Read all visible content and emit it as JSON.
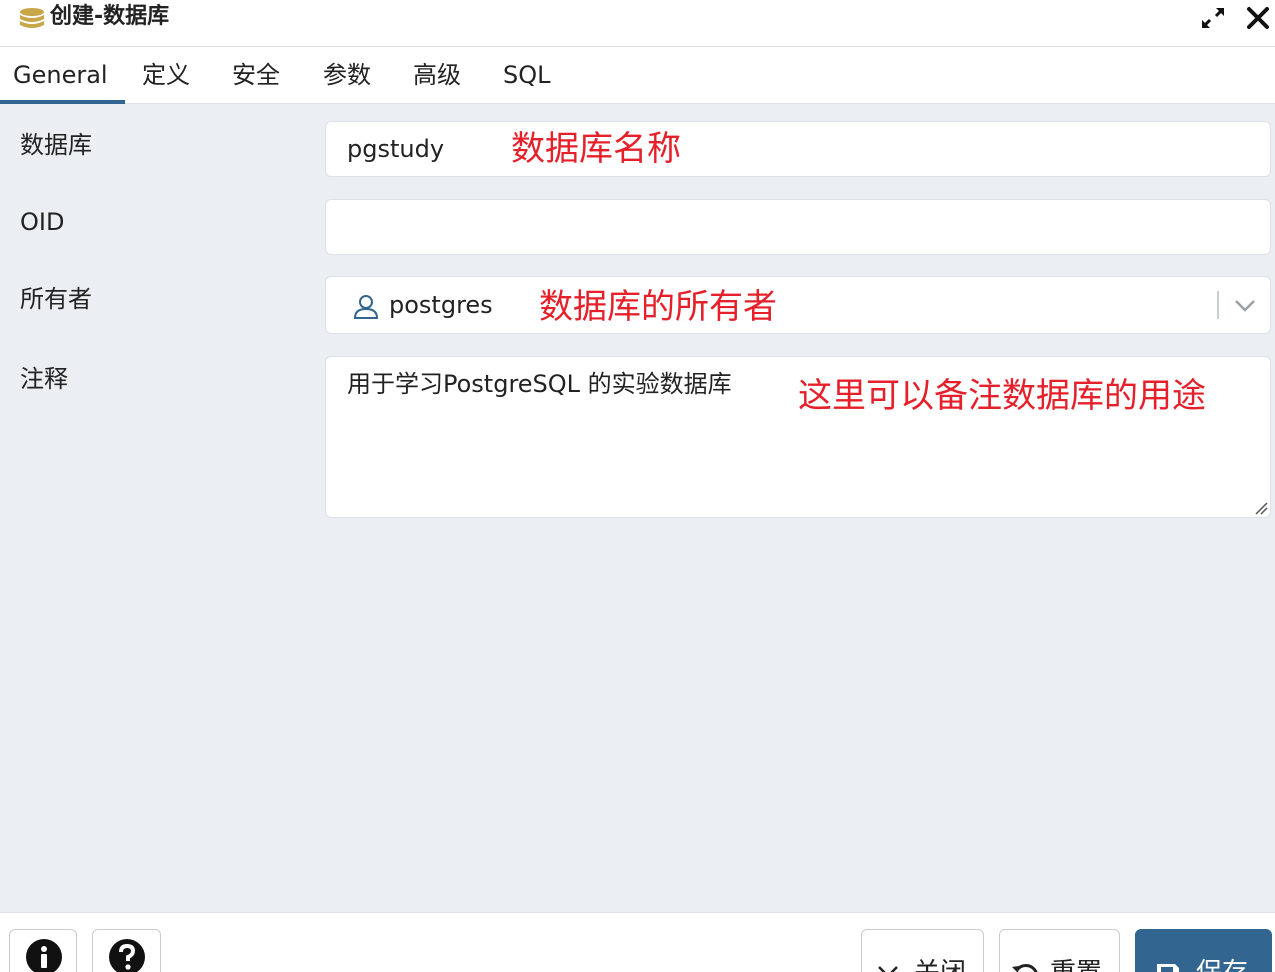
{
  "dialog": {
    "title": "创建-数据库",
    "icon": "database-icon",
    "expand_icon": "expand-icon",
    "close_icon": "close-icon"
  },
  "tabs": [
    {
      "label": "General",
      "active": true
    },
    {
      "label": "定义",
      "active": false
    },
    {
      "label": "安全",
      "active": false
    },
    {
      "label": "参数",
      "active": false
    },
    {
      "label": "高级",
      "active": false
    },
    {
      "label": "SQL",
      "active": false
    }
  ],
  "form": {
    "database": {
      "label": "数据库",
      "value": "pgstudy",
      "annotation": "数据库名称"
    },
    "oid": {
      "label": "OID",
      "value": ""
    },
    "owner": {
      "label": "所有者",
      "value": "postgres",
      "icon": "user-icon",
      "annotation": "数据库的所有者"
    },
    "comment": {
      "label": "注释",
      "value": "用于学习PostgreSQL 的实验数据库",
      "annotation": "这里可以备注数据库的用途"
    }
  },
  "footer": {
    "info_icon": "info-icon",
    "help_icon": "help-icon",
    "close_label": "关闭",
    "reset_label": "重置",
    "save_label": "保存"
  },
  "colors": {
    "accent": "#326690",
    "annotation": "#e5202a",
    "panel_bg": "#ebeef3",
    "db_icon": "#c8a74a"
  }
}
